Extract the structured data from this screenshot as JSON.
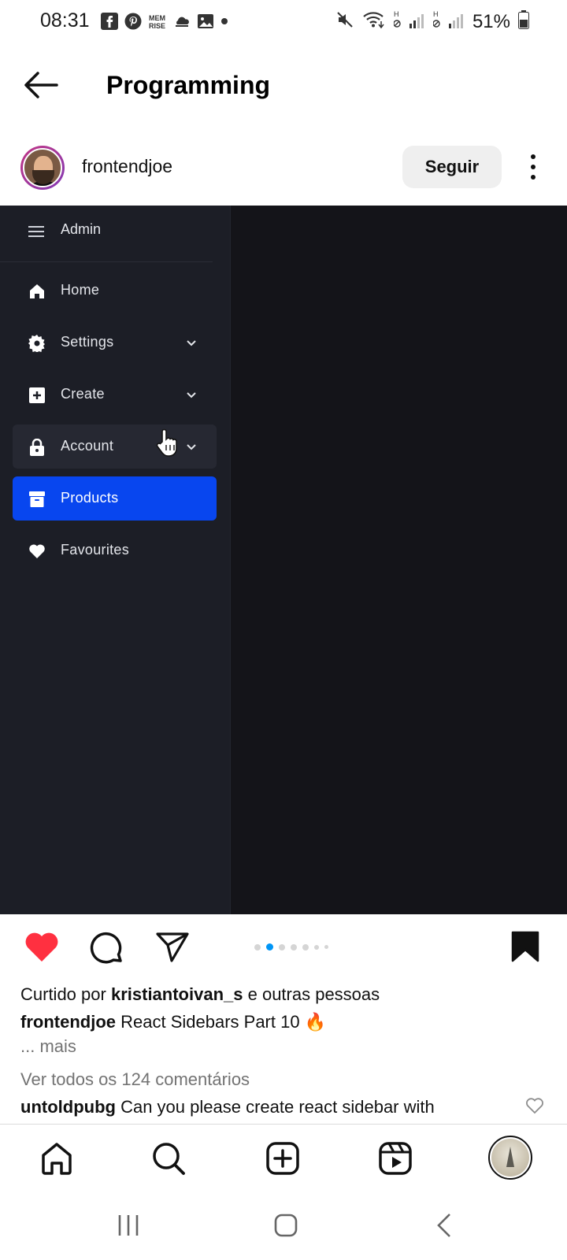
{
  "status_bar": {
    "time": "08:31",
    "notification_icons": [
      "facebook-icon",
      "pinterest-icon",
      "memrise-icon",
      "cloud-icon",
      "gallery-icon",
      "dot-icon"
    ],
    "battery_text": "51%",
    "sim1_label": "H",
    "sim2_label": "H"
  },
  "header": {
    "title": "Programming"
  },
  "post": {
    "author": "frontendjoe",
    "follow_label": "Seguir",
    "media": {
      "sidebar_title": "Admin",
      "nav_items": [
        {
          "label": "Home",
          "icon": "home-icon",
          "has_chevron": false,
          "state": "normal"
        },
        {
          "label": "Settings",
          "icon": "gear-icon",
          "has_chevron": true,
          "state": "normal"
        },
        {
          "label": "Create",
          "icon": "plus-square-icon",
          "has_chevron": true,
          "state": "normal"
        },
        {
          "label": "Account",
          "icon": "lock-icon",
          "has_chevron": true,
          "state": "hover"
        },
        {
          "label": "Products",
          "icon": "archive-icon",
          "has_chevron": false,
          "state": "active"
        },
        {
          "label": "Favourites",
          "icon": "heart-icon",
          "has_chevron": false,
          "state": "normal"
        }
      ],
      "accent_color": "#0846ef"
    },
    "carousel": {
      "total": 7,
      "current": 2
    },
    "likes_prefix": "Curtido por",
    "likes_user": "kristiantoivan_s",
    "likes_suffix": "e outras pessoas",
    "caption_user": "frontendjoe",
    "caption_text": "React Sidebars Part 10 🔥",
    "more_label": "... mais",
    "view_comments": "Ver todos os 124 comentários",
    "comment_user": "untoldpubg",
    "comment_text": "Can you please create react sidebar with"
  },
  "colors": {
    "like_red": "#ff3040",
    "carousel_active": "#0095f6"
  }
}
